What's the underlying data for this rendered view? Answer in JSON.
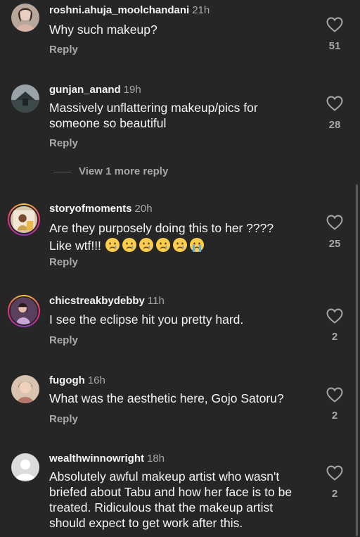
{
  "comments": [
    {
      "username": "roshni.ahuja_moolchandani",
      "time": "21h",
      "text": "Why such makeup?",
      "reply_label": "Reply",
      "likes": "51",
      "avatar": "avatar-photo"
    },
    {
      "username": "gunjan_anand",
      "time": "19h",
      "text": "Massively unflattering makeup/pics for someone so beautiful",
      "reply_label": "Reply",
      "likes": "28",
      "view_more": "View 1 more reply",
      "avatar": "avatar-photo"
    },
    {
      "username": "storyofmoments",
      "time": "20h",
      "text_line1": "Are they purposely doing this to her ????",
      "text_line2": "Like wtf!!!",
      "emojis": [
        "crying-face-emoji",
        "crying-face-emoji",
        "crying-face-emoji",
        "crying-face-emoji",
        "crying-face-emoji",
        "loudly-crying-face-emoji"
      ],
      "reply_label": "Reply",
      "likes": "25",
      "avatar": "story-ring-avatar"
    },
    {
      "username": "chicstreakbydebby",
      "time": "11h",
      "text": "I see the eclipse hit you pretty hard.",
      "reply_label": "Reply",
      "likes": "2",
      "avatar": "story-ring-avatar"
    },
    {
      "username": "fugogh",
      "time": "16h",
      "text": "What was the aesthetic here, Gojo Satoru?",
      "reply_label": "Reply",
      "likes": "2",
      "avatar": "avatar-photo"
    },
    {
      "username": "wealthwinnowright",
      "time": "18h",
      "text": "Absolutely awful makeup artist who wasn't briefed about Tabu and how her face is to be treated. Ridiculous that the makeup artist should expect to get work after this.",
      "likes": "2",
      "avatar": "default-avatar"
    }
  ],
  "icons": {
    "like": "heart-outline-icon"
  },
  "colors": {
    "background": "#262626",
    "primary_text": "#f5f5f5",
    "secondary_text": "#a8a8a8"
  }
}
